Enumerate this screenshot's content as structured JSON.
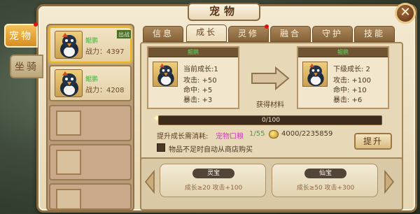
{
  "window": {
    "title": "宠物"
  },
  "side_tabs": [
    {
      "label": "宠物",
      "active": true
    },
    {
      "label": "坐骑",
      "active": false
    }
  ],
  "pet_list": [
    {
      "name": "鲲鹏",
      "power_label": "战力：",
      "power": "4397",
      "badge": "出战",
      "selected": true
    },
    {
      "name": "鲲鹏",
      "power_label": "战力：",
      "power": "4208",
      "badge": "",
      "selected": false
    }
  ],
  "tabs": [
    {
      "label": "信息",
      "active": false,
      "dot": false
    },
    {
      "label": "成长",
      "active": true,
      "dot": false
    },
    {
      "label": "灵修",
      "active": false,
      "dot": true
    },
    {
      "label": "融合",
      "active": false,
      "dot": false
    },
    {
      "label": "守护",
      "active": false,
      "dot": false
    },
    {
      "label": "技能",
      "active": false,
      "dot": false
    }
  ],
  "current": {
    "name": "鲲鹏",
    "growth": "当前成长:1",
    "attack": "攻击: +50",
    "hit": "命中: +5",
    "crit": "暴击: +3"
  },
  "next": {
    "name": "鲲鹏",
    "growth": "下级成长: 2",
    "attack": "攻击: +100",
    "hit": "命中: +10",
    "crit": "暴击: +6"
  },
  "material_label": "获得材料",
  "progress": {
    "text": "0/100",
    "value": 0,
    "max": 100
  },
  "cost": {
    "label": "提升成长需消耗:",
    "item": "宠物口粮",
    "item_count": "1/55",
    "gold": "4000/2235859"
  },
  "auto_buy_label": "物品不足时自动从商店购买",
  "upgrade_button": "提升",
  "milestones": [
    {
      "title": "灵宝",
      "desc": "成长≥20 攻击+100"
    },
    {
      "title": "仙宝",
      "desc": "成长≥50 攻击+300"
    }
  ],
  "colors": {
    "parchment": "#f4ead2",
    "frame": "#8b6b42",
    "green_name": "#3cb93c",
    "item_pink": "#d43cbf",
    "item_green": "#3ca63c",
    "notify_red": "#e01010"
  },
  "icons": [
    "close-icon",
    "coin-icon",
    "arrow-right-icon",
    "arrow-left-icon",
    "penguin-pet-icon"
  ]
}
